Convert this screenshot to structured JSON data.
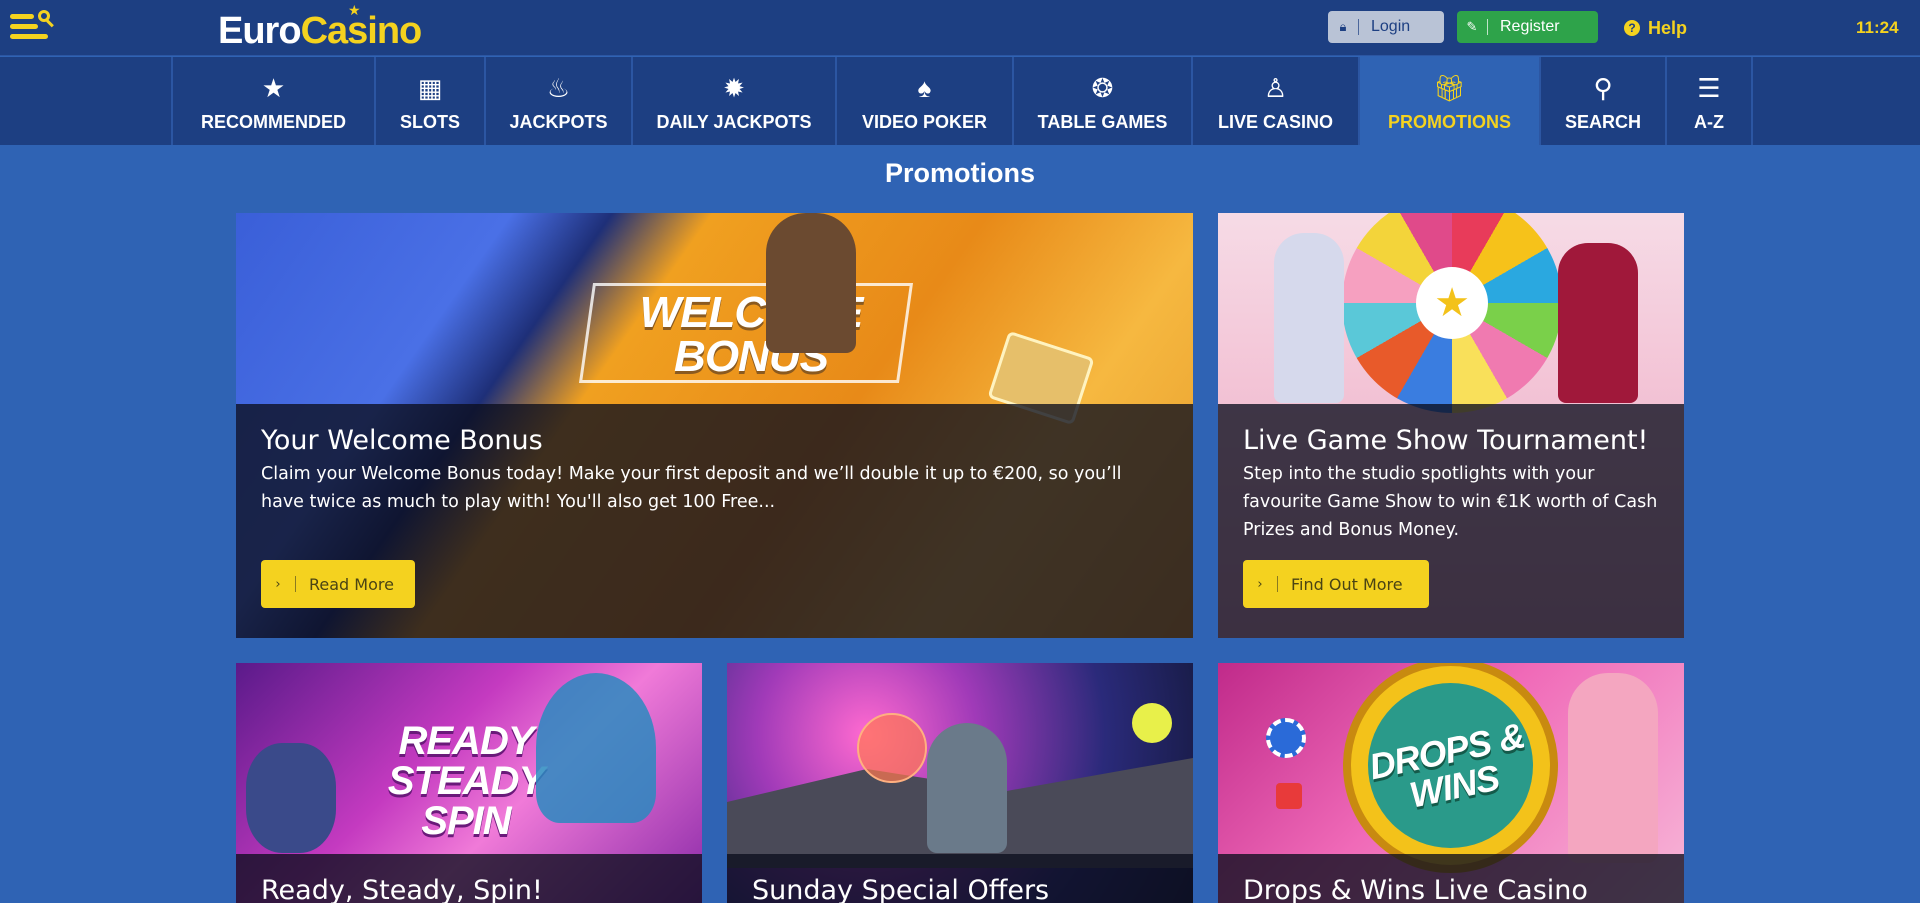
{
  "header": {
    "logo_part1": "Euro",
    "logo_part2": "Casino",
    "login_label": "Login",
    "register_label": "Register",
    "help_label": "Help",
    "time": "11:24"
  },
  "categories": [
    {
      "label": "RECOMMENDED",
      "icon": "★"
    },
    {
      "label": "SLOTS",
      "icon": "▦"
    },
    {
      "label": "JACKPOTS",
      "icon": "♠"
    },
    {
      "label": "DAILY JACKPOTS",
      "icon": "✹"
    },
    {
      "label": "VIDEO POKER",
      "icon": "♠"
    },
    {
      "label": "TABLE GAMES",
      "icon": "❂"
    },
    {
      "label": "LIVE CASINO",
      "icon": "♙"
    },
    {
      "label": "PROMOTIONS",
      "icon": "🎁︎"
    },
    {
      "label": "SEARCH",
      "icon": "⚲"
    },
    {
      "label": "A-Z",
      "icon": "☰"
    }
  ],
  "page_title": "Promotions",
  "promos": [
    {
      "title": "Your Welcome Bonus",
      "description": "Claim your Welcome Bonus today! Make your first deposit and we’ll double it up to €200, so you’ll have twice as much to play with! You'll also get 100 Free...",
      "cta": "Read More",
      "art_text": "WELCOME BONUS"
    },
    {
      "title": "Live Game Show Tournament!",
      "description": "Step into the studio spotlights with your favourite Game Show to win €1K worth of Cash Prizes and Bonus Money.",
      "cta": "Find Out More"
    },
    {
      "title": "Ready, Steady, Spin!",
      "art_text": "READY STEADY SPIN"
    },
    {
      "title": "Sunday Special Offers"
    },
    {
      "title": "Drops & Wins Live Casino",
      "art_text": "DROPS & WINS"
    }
  ]
}
